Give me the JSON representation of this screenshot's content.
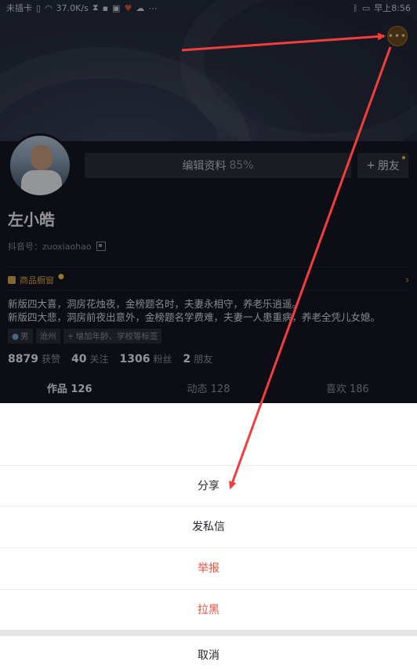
{
  "status_bar": {
    "carrier": "未插卡",
    "speed": "37.0K/s",
    "time": "早上8:56"
  },
  "header": {
    "more_button_label": "•••"
  },
  "profile": {
    "edit_label": "编辑资料",
    "edit_percent": "85%",
    "friend_label": "朋友",
    "name": "左小皓",
    "douyin_id": "抖音号：zuoxiaohao",
    "shop_label": "商品橱窗",
    "bio_line1": "新版四大喜，洞房花烛夜，金榜题名时，夫妻永相守，养老乐逍遥。",
    "bio_line2": "新版四大悲，洞房前夜出意外，金榜题名学费难，夫妻一人患重病，养老全凭儿女媳。",
    "tags": [
      "男",
      "沧州",
      "增加年龄、学校等标签"
    ],
    "stats": [
      {
        "num": "8879",
        "label": "获赞"
      },
      {
        "num": "40",
        "label": "关注"
      },
      {
        "num": "1306",
        "label": "粉丝"
      },
      {
        "num": "2",
        "label": "朋友"
      }
    ],
    "tabs": [
      "作品 126",
      "动态 128",
      "喜欢 186"
    ]
  },
  "sheet": {
    "share": "分享",
    "message": "发私信",
    "report": "举报",
    "block": "拉黑",
    "cancel": "取消"
  },
  "colors": {
    "accent_red": "#f23d3d",
    "danger": "#e0523c",
    "gold": "#d3a74c"
  }
}
